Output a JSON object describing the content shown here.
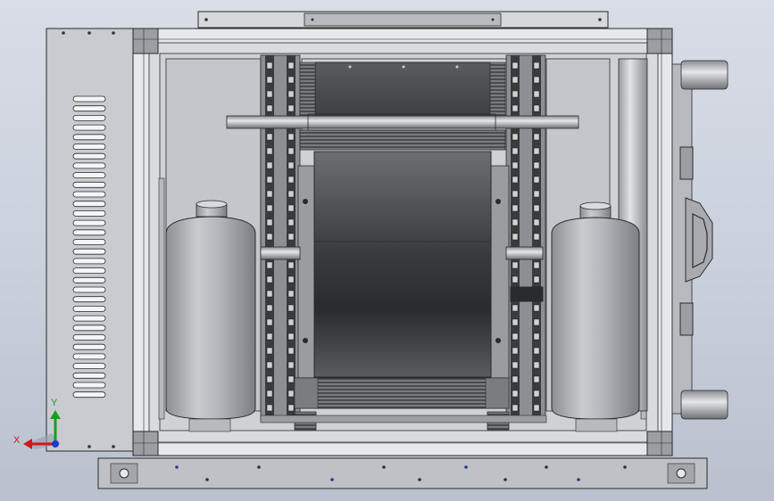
{
  "viewport": {
    "background_top": "#d8dde6",
    "background_bottom": "#b9c1cf"
  },
  "triad": {
    "x_label": "X",
    "y_label": "Y",
    "x_color": "#d01818",
    "y_color": "#18a018",
    "z_color": "#1a3cc8"
  },
  "model": {
    "frame_color": "#e6e8ec",
    "edge_color": "#2a2a2a",
    "panel_color": "#c9cbd0",
    "tank_color": "#b4b6bb",
    "components": [
      "side-louver-panel",
      "main-frame",
      "top-rail",
      "upper-motor-block",
      "blower-housing",
      "left-rack",
      "right-rack",
      "left-tank",
      "right-tank",
      "horizontal-shaft",
      "lower-coil",
      "spring-mounts",
      "right-pipe-fittings",
      "base-rail"
    ]
  }
}
